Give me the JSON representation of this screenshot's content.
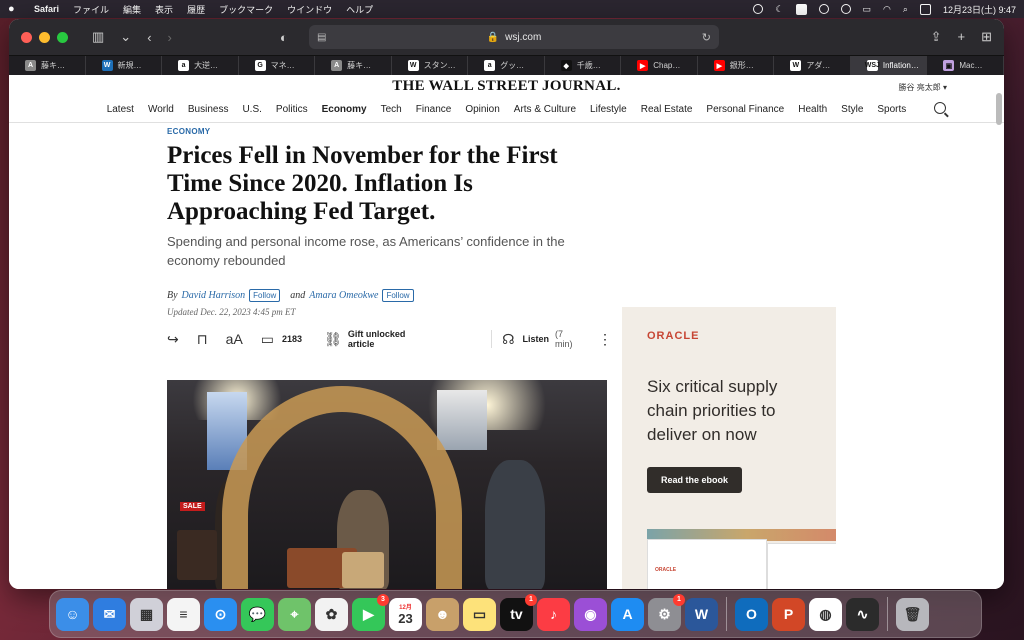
{
  "menubar": {
    "app": "Safari",
    "menus": [
      "ファイル",
      "編集",
      "表示",
      "履歴",
      "ブックマーク",
      "ウインドウ",
      "ヘルプ"
    ],
    "clock": "12月23日(土) 9:47"
  },
  "browser": {
    "url": "wsj.com",
    "tabs": [
      {
        "label": "藤キ…",
        "fav": "A",
        "color": "#8a8a8a"
      },
      {
        "label": "新規…",
        "fav": "W",
        "color": "#1d6fb8"
      },
      {
        "label": "大逆…",
        "fav": "a",
        "color": "#ffffff"
      },
      {
        "label": "マネ…",
        "fav": "G",
        "color": "#ffffff"
      },
      {
        "label": "藤キ…",
        "fav": "A",
        "color": "#8a8a8a"
      },
      {
        "label": "スタン…",
        "fav": "W",
        "color": "#ffffff"
      },
      {
        "label": "グッ…",
        "fav": "a",
        "color": "#ffffff"
      },
      {
        "label": "千歳…",
        "fav": "◆",
        "color": "#111111"
      },
      {
        "label": "Chap…",
        "fav": "▶",
        "color": "#ff0000"
      },
      {
        "label": "銀形…",
        "fav": "▶",
        "color": "#ff0000"
      },
      {
        "label": "アダ…",
        "fav": "W",
        "color": "#ffffff"
      },
      {
        "label": "Inflation…",
        "fav": "WSJ",
        "color": "#ffffff",
        "active": true
      },
      {
        "label": "Mac…",
        "fav": "▣",
        "color": "#c0a0e0"
      }
    ]
  },
  "wsj": {
    "logo": "THE WALL STREET JOURNAL.",
    "user": "勝谷 亮太郎 ▾",
    "nav": [
      "Latest",
      "World",
      "Business",
      "U.S.",
      "Politics",
      "Economy",
      "Tech",
      "Finance",
      "Opinion",
      "Arts & Culture",
      "Lifestyle",
      "Real Estate",
      "Personal Finance",
      "Health",
      "Style",
      "Sports"
    ],
    "nav_active": "Economy"
  },
  "article": {
    "kicker": "ECONOMY",
    "headline": "Prices Fell in November for the First Time Since 2020. Inflation Is Approaching Fed Target.",
    "dek": "Spending and personal income rose, as Americans’ confidence in the economy rebounded",
    "by": "By",
    "author1": "David Harrison",
    "and": "and",
    "author2": "Amara Omeokwe",
    "follow": "Follow",
    "updated": "Updated Dec. 22, 2023 4:45 pm ET",
    "comments": "2183",
    "gift": "Gift unlocked article",
    "listen": "Listen",
    "duration": "(7 min)",
    "photo_sale": "SALE"
  },
  "ad": {
    "brand": "ORACLE",
    "copy": "Six critical supply chain priorities to deliver on now",
    "cta": "Read the ebook",
    "mini_brand": "ORACLE"
  },
  "dock": {
    "apps": [
      {
        "name": "finder",
        "color": "#3b8ee8",
        "glyph": "☺"
      },
      {
        "name": "mail",
        "color": "#2f7de0",
        "glyph": "✉"
      },
      {
        "name": "launchpad",
        "color": "#d0d0d8",
        "glyph": "▦"
      },
      {
        "name": "reminders",
        "color": "#f4f4f4",
        "glyph": "≡"
      },
      {
        "name": "safari",
        "color": "#2a8ff0",
        "glyph": "⊙"
      },
      {
        "name": "messages",
        "color": "#35c759",
        "glyph": "💬"
      },
      {
        "name": "maps",
        "color": "#6fc36a",
        "glyph": "⌖"
      },
      {
        "name": "photos",
        "color": "#f2f2f2",
        "glyph": "✿"
      },
      {
        "name": "facetime",
        "color": "#34c759",
        "glyph": "▶",
        "badge": "3"
      },
      {
        "name": "calendar",
        "color": "#ffffff",
        "glyph": "23",
        "top": "12月"
      },
      {
        "name": "contacts",
        "color": "#c8a06a",
        "glyph": "☻"
      },
      {
        "name": "notes",
        "color": "#fde27a",
        "glyph": "▭"
      },
      {
        "name": "apple-tv",
        "color": "#111111",
        "glyph": "tv",
        "badge": "1"
      },
      {
        "name": "music",
        "color": "#fc3c44",
        "glyph": "♪"
      },
      {
        "name": "podcasts",
        "color": "#9b4fd6",
        "glyph": "◉"
      },
      {
        "name": "app-store",
        "color": "#1e8cf2",
        "glyph": "A"
      },
      {
        "name": "system-settings",
        "color": "#8e8e93",
        "glyph": "⚙",
        "badge": "1"
      },
      {
        "name": "word",
        "color": "#2b579a",
        "glyph": "W"
      },
      {
        "name": "outlook",
        "color": "#0f6cbd",
        "glyph": "O"
      },
      {
        "name": "powerpoint",
        "color": "#d24726",
        "glyph": "P"
      },
      {
        "name": "chrome",
        "color": "#ffffff",
        "glyph": "◍"
      },
      {
        "name": "activity-monitor",
        "color": "#2b2b2b",
        "glyph": "∿"
      },
      {
        "name": "trash",
        "color": "#b7b7bc",
        "glyph": "🗑"
      }
    ]
  }
}
